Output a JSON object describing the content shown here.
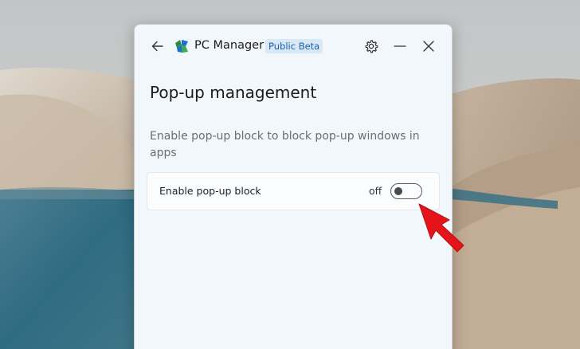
{
  "app": {
    "title": "PC Manager",
    "badge": "Public Beta"
  },
  "page": {
    "title": "Pop-up management",
    "description": "Enable pop-up block to block pop-up windows in apps"
  },
  "setting": {
    "label": "Enable pop-up block",
    "state_label": "off",
    "enabled": false
  },
  "icons": {
    "back": "back-arrow-icon",
    "logo": "pc-manager-logo-icon",
    "settings": "gear-icon",
    "minimize": "minimize-icon",
    "close": "close-icon",
    "annotation": "red-arrow-icon"
  },
  "colors": {
    "window_bg": "#f2f7fc",
    "badge_bg": "#d9e8f7",
    "badge_text": "#1a5fa8",
    "annotation": "#e3151b"
  }
}
